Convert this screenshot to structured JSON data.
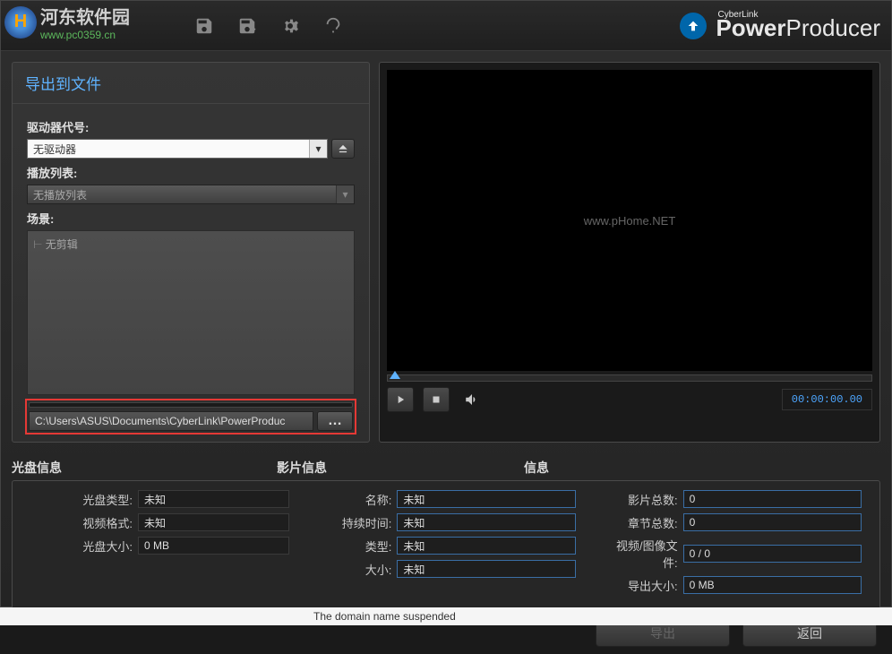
{
  "watermark": {
    "site": "河东软件园",
    "url": "www.pc0359.cn"
  },
  "brand": {
    "company": "CyberLink",
    "product_bold": "Power",
    "product_rest": "Producer"
  },
  "panel": {
    "title": "导出到文件",
    "drive_label": "驱动器代号:",
    "drive_value": "无驱动器",
    "playlist_label": "播放列表:",
    "playlist_value": "无播放列表",
    "scene_label": "场景:",
    "scene_item": "无剪辑",
    "path": "C:\\Users\\ASUS\\Documents\\CyberLink\\PowerProduc",
    "browse": "…"
  },
  "preview": {
    "watermark": "www.pHome.NET",
    "timecode": "00:00:00.00"
  },
  "tabs": {
    "disc_info": "光盘信息",
    "movie_info": "影片信息",
    "info": "信息"
  },
  "disc": {
    "type_label": "光盘类型:",
    "type_value": "未知",
    "video_format_label": "视频格式:",
    "video_format_value": "未知",
    "size_label": "光盘大小:",
    "size_value": "0 MB"
  },
  "movie": {
    "name_label": "名称:",
    "name_value": "未知",
    "duration_label": "持续时间:",
    "duration_value": "未知",
    "type_label": "类型:",
    "type_value": "未知",
    "size_label": "大小:",
    "size_value": "未知"
  },
  "stats": {
    "movies_label": "影片总数:",
    "movies_value": "0",
    "chapters_label": "章节总数:",
    "chapters_value": "0",
    "files_label": "视频/图像文件:",
    "files_value": "0 / 0",
    "export_size_label": "导出大小:",
    "export_size_value": "0 MB"
  },
  "buttons": {
    "export": "导出",
    "back": "返回"
  },
  "status": "The domain name suspended"
}
